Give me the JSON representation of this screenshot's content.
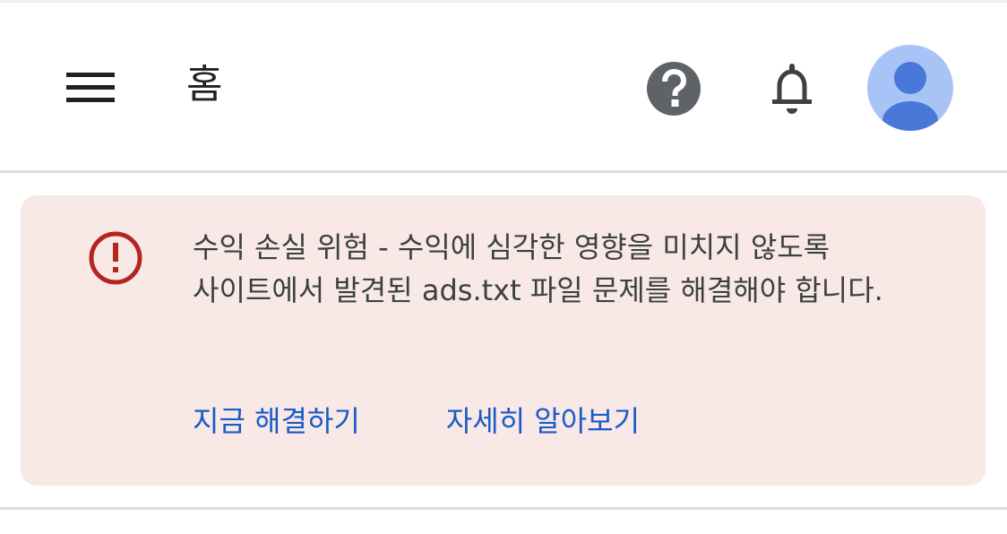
{
  "header": {
    "title": "홈",
    "menu_icon": "hamburger-menu-icon",
    "help_icon": "help-icon",
    "notifications_icon": "bell-icon",
    "avatar_icon": "account-avatar-icon"
  },
  "alert": {
    "icon": "error-icon",
    "message": "수익 손실 위험 - 수익에 심각한 영향을 미치지 않도록 사이트에서 발견된 ads.txt 파일 문제를 해결해야 합니다.",
    "actions": [
      {
        "label": "지금 해결하기"
      },
      {
        "label": "자세히 알아보기"
      }
    ]
  },
  "colors": {
    "text_primary": "#202124",
    "icon_gray": "#5f6368",
    "alert_background": "#f8e8e6",
    "alert_icon": "#b3261e",
    "link": "#1a5ac6",
    "avatar_background": "#a8c4f7",
    "avatar_figure": "#4a78d9"
  }
}
